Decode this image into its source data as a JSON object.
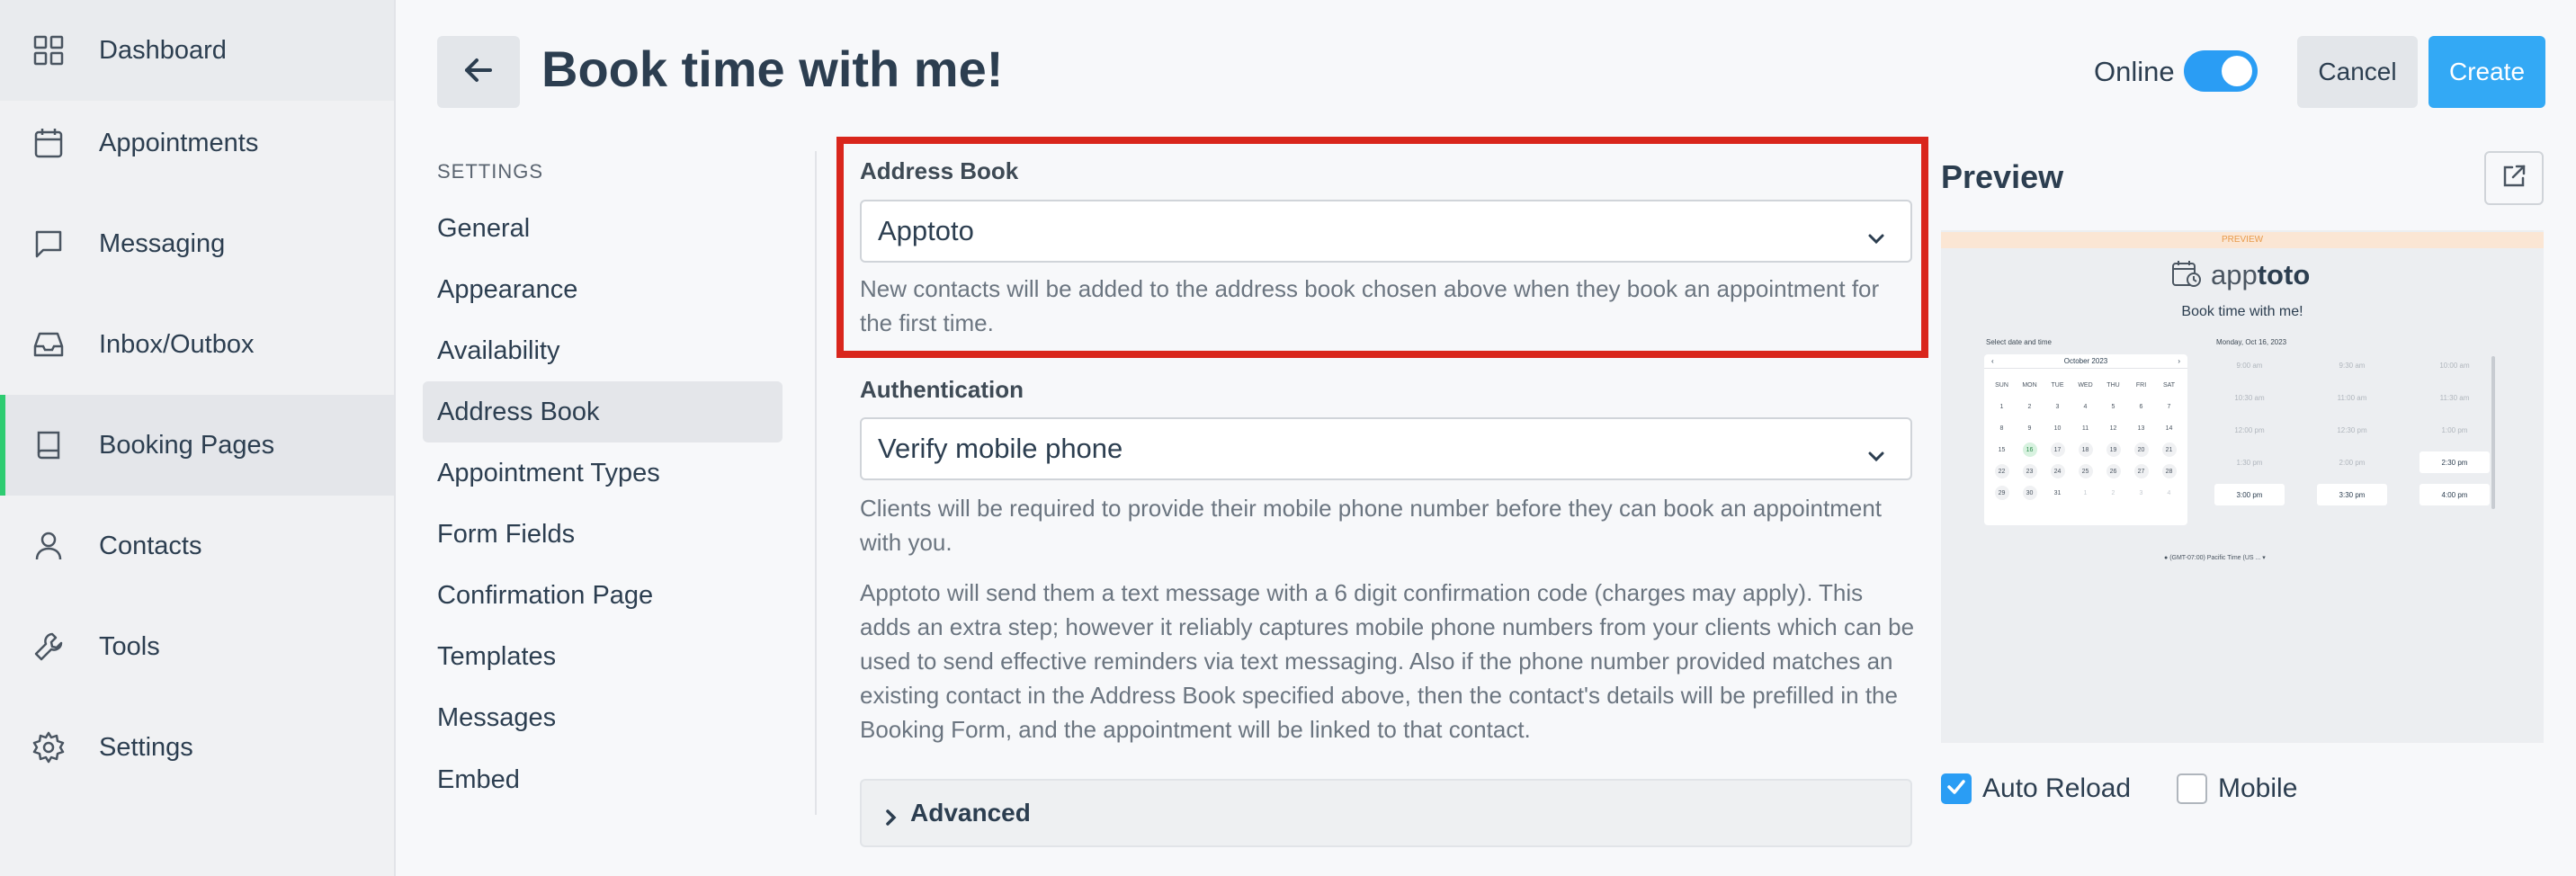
{
  "sidebar": {
    "items": [
      {
        "label": "Dashboard",
        "icon": "grid-icon"
      },
      {
        "label": "Appointments",
        "icon": "calendar-icon"
      },
      {
        "label": "Messaging",
        "icon": "chat-icon"
      },
      {
        "label": "Inbox/Outbox",
        "icon": "inbox-icon"
      },
      {
        "label": "Booking Pages",
        "icon": "book-icon",
        "active": true
      },
      {
        "label": "Contacts",
        "icon": "user-icon"
      },
      {
        "label": "Tools",
        "icon": "wrench-icon"
      },
      {
        "label": "Settings",
        "icon": "gear-icon"
      }
    ]
  },
  "header": {
    "title": "Book time with me!",
    "online_label": "Online",
    "online_state": true,
    "cancel_label": "Cancel",
    "create_label": "Create"
  },
  "settings": {
    "heading": "SETTINGS",
    "items": [
      "General",
      "Appearance",
      "Availability",
      "Address Book",
      "Appointment Types",
      "Form Fields",
      "Confirmation Page",
      "Templates",
      "Messages",
      "Embed"
    ],
    "active_index": 3
  },
  "form": {
    "address_book": {
      "label": "Address Book",
      "value": "Apptoto",
      "help": "New contacts will be added to the address book chosen above when they book an appointment for the first time."
    },
    "authentication": {
      "label": "Authentication",
      "value": "Verify mobile phone",
      "help1": "Clients will be required to provide their mobile phone number before they can book an appointment with you.",
      "help2": "Apptoto will send them a text message with a 6 digit confirmation code (charges may apply). This adds an extra step; however it reliably captures mobile phone numbers from your clients which can be used to send effective reminders via text messaging. Also if the phone number provided matches an existing contact in the Address Book specified above, then the contact's details will be prefilled in the Booking Form, and the appointment will be linked to that contact."
    },
    "advanced_label": "Advanced"
  },
  "preview": {
    "title": "Preview",
    "banner": "PREVIEW",
    "logo_text_light": "app",
    "logo_text_bold": "toto",
    "heading": "Book time with me!",
    "select_label": "Select date and time",
    "date_label": "Monday, Oct 16, 2023",
    "month_label": "October 2023",
    "weekdays": [
      "SUN",
      "MON",
      "TUE",
      "WED",
      "THU",
      "FRI",
      "SAT"
    ],
    "days": [
      "1",
      "2",
      "3",
      "4",
      "5",
      "6",
      "7",
      "8",
      "9",
      "10",
      "11",
      "12",
      "13",
      "14",
      "15",
      "16",
      "17",
      "18",
      "19",
      "20",
      "21",
      "22",
      "23",
      "24",
      "25",
      "26",
      "27",
      "28",
      "29",
      "30",
      "31",
      "1",
      "2",
      "3",
      "4"
    ],
    "slots": [
      {
        "label": "9:00 am",
        "on": false
      },
      {
        "label": "9:30 am",
        "on": false
      },
      {
        "label": "10:00 am",
        "on": false
      },
      {
        "label": "10:30 am",
        "on": false
      },
      {
        "label": "11:00 am",
        "on": false
      },
      {
        "label": "11:30 am",
        "on": false
      },
      {
        "label": "12:00 pm",
        "on": false
      },
      {
        "label": "12:30 pm",
        "on": false
      },
      {
        "label": "1:00 pm",
        "on": false
      },
      {
        "label": "1:30 pm",
        "on": false
      },
      {
        "label": "2:00 pm",
        "on": false
      },
      {
        "label": "2:30 pm",
        "on": true
      },
      {
        "label": "3:00 pm",
        "on": true
      },
      {
        "label": "3:30 pm",
        "on": true
      },
      {
        "label": "4:00 pm",
        "on": true
      }
    ],
    "timezone": "(GMT-07:00) Pacific Time (US ..."
  },
  "options": {
    "auto_reload_label": "Auto Reload",
    "auto_reload_checked": true,
    "mobile_label": "Mobile",
    "mobile_checked": false
  },
  "colors": {
    "accent": "#2a9df4",
    "active_bar": "#2ecc71",
    "highlight": "#d9261c"
  }
}
